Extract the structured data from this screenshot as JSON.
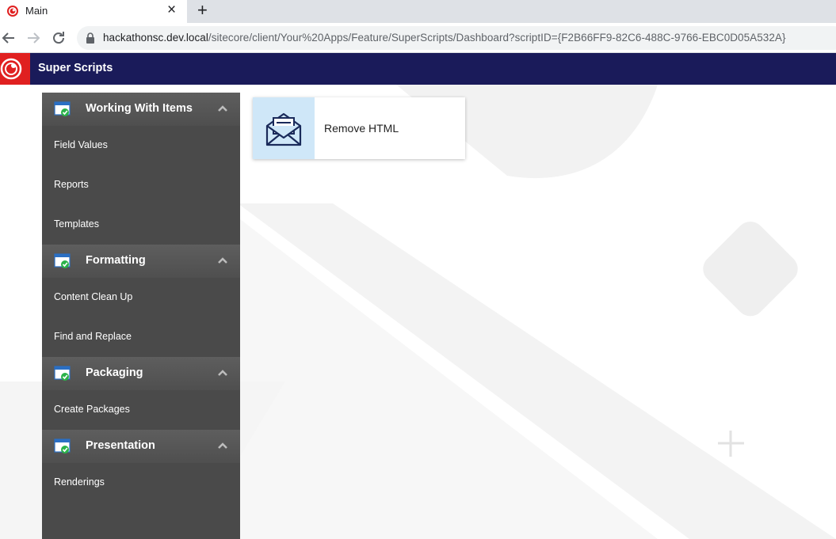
{
  "browser": {
    "tab_title": "Main",
    "close_glyph": "×",
    "new_tab_glyph": "+",
    "url_host": "hackathonsc.dev.local",
    "url_path": "/sitecore/client/Your%20Apps/Feature/SuperScripts/Dashboard?scriptID={F2B66FF9-82C6-488C-9766-EBC0D05A532A}"
  },
  "app": {
    "title": "Super Scripts",
    "header_color": "#1a1b5a",
    "logo_color": "#e02020"
  },
  "sidebar": {
    "sections": [
      {
        "title": "Working With Items",
        "items": [
          "Field Values",
          "Reports",
          "Templates"
        ]
      },
      {
        "title": "Formatting",
        "items": [
          "Content Clean Up",
          "Find and Replace"
        ]
      },
      {
        "title": "Packaging",
        "items": [
          "Create Packages"
        ]
      },
      {
        "title": "Presentation",
        "items": [
          "Renderings"
        ]
      }
    ],
    "section_icon": "window-check-icon",
    "chevron_icon": "chevron-up-icon"
  },
  "cards": [
    {
      "label": "Remove HTML",
      "icon": "envelope-icon"
    }
  ]
}
